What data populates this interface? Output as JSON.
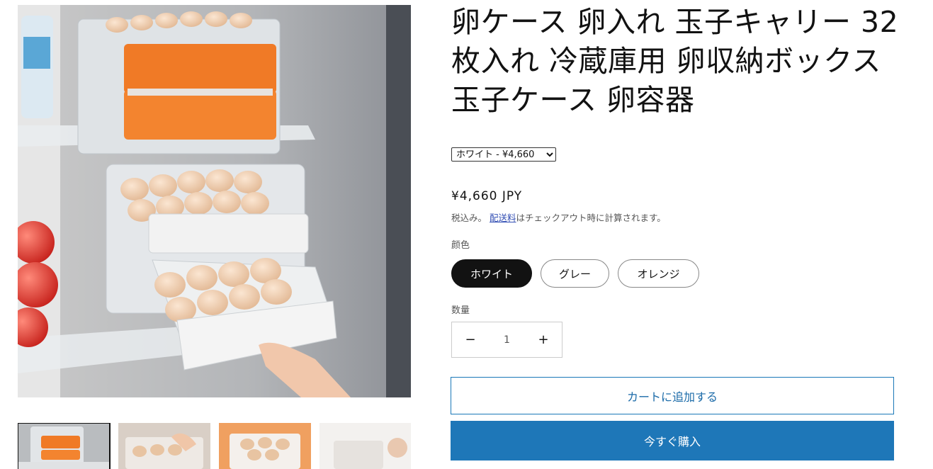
{
  "product": {
    "title": "卵ケース 卵入れ 玉子キャリー 32枚入れ 冷蔵庫用 卵収納ボックス 玉子ケース 卵容器",
    "variant_select": {
      "selected": "ホワイト - ¥4,660"
    },
    "price": "¥4,660 JPY",
    "tax_note": {
      "prefix": "税込み。",
      "link": "配送料",
      "suffix": "はチェックアウト時に計算されます。"
    },
    "color": {
      "label": "颜色",
      "options": [
        "ホワイト",
        "グレー",
        "オレンジ"
      ],
      "selected_index": 0
    },
    "quantity": {
      "label": "数量",
      "value": "1",
      "minus": "−",
      "plus": "+"
    },
    "add_to_cart": "カートに追加する",
    "buy_now": "今すぐ購入"
  },
  "colors": {
    "primary_button": "#1e77b8",
    "outline_button": "#1a78b8",
    "selected_pill": "#121212",
    "link": "#334fb4"
  }
}
